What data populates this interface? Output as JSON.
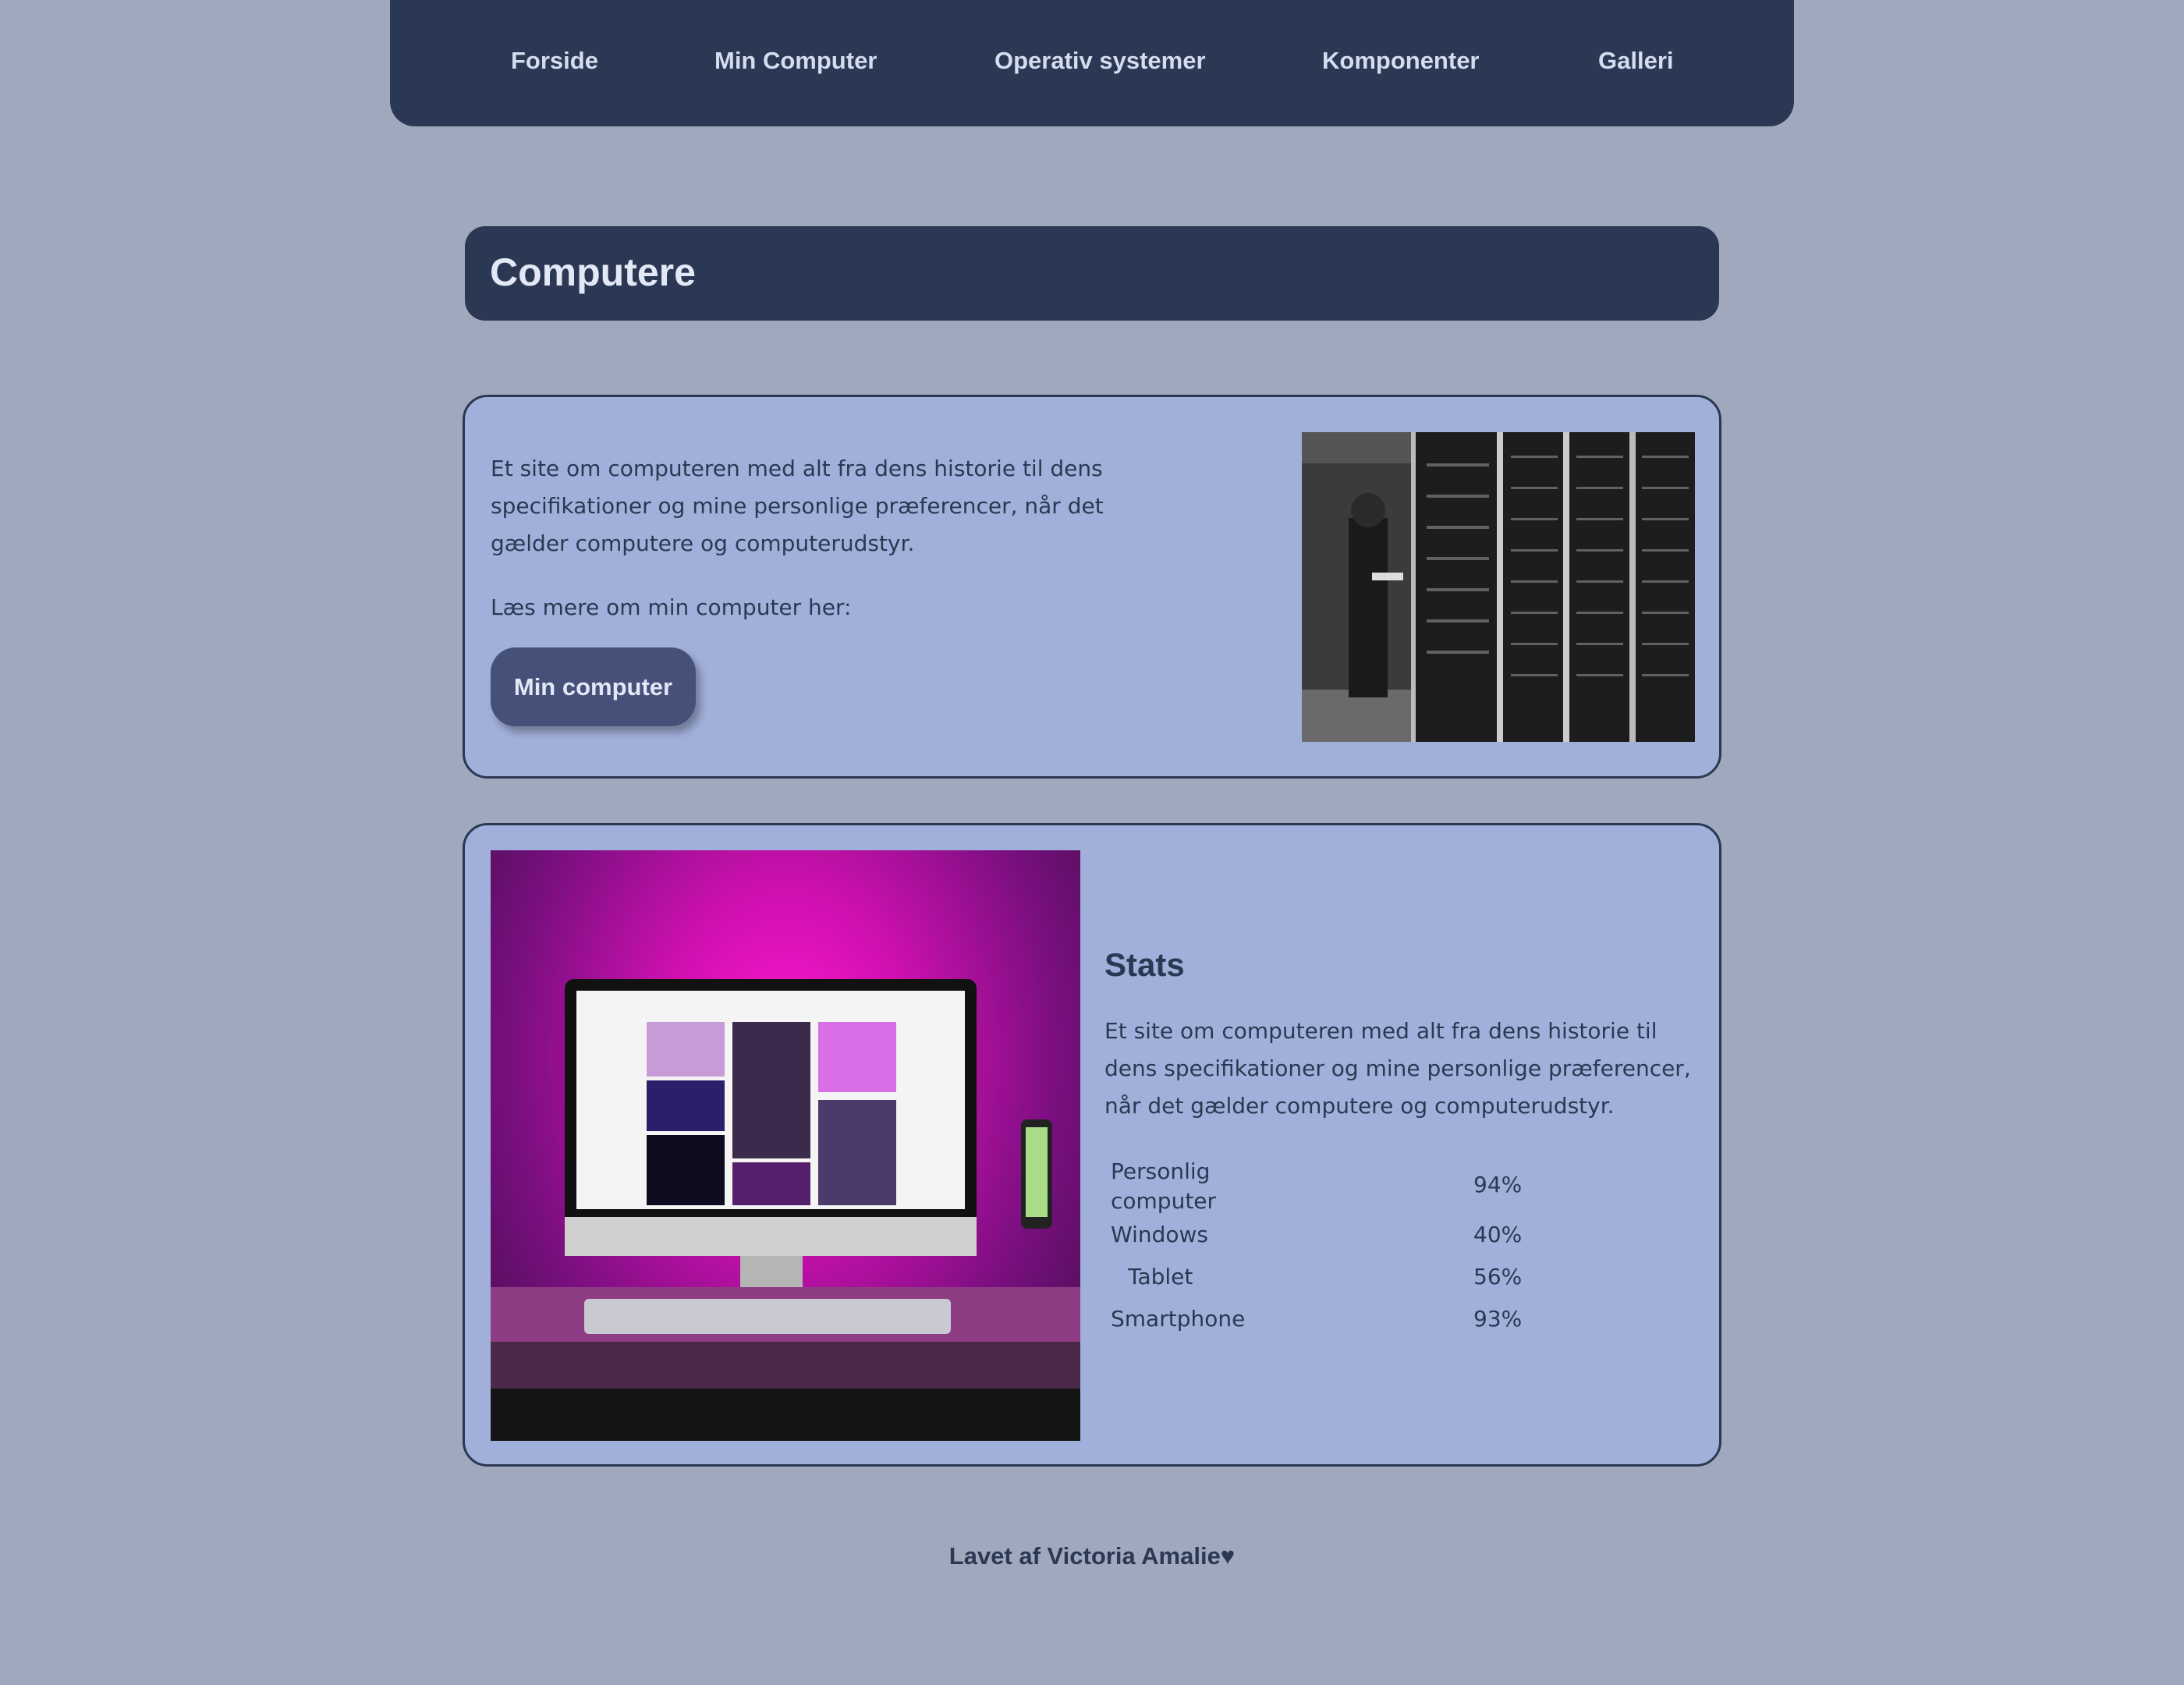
{
  "nav": {
    "items": [
      {
        "label": "Forside"
      },
      {
        "label": "Min Computer"
      },
      {
        "label": "Operativ systemer"
      },
      {
        "label": "Komponenter"
      },
      {
        "label": "Galleri"
      }
    ]
  },
  "header": {
    "title": "Computere"
  },
  "intro_card": {
    "text": "Et site om computeren med alt fra dens historie til dens specifikationer og mine personlige præferencer, når det gælder computere og computerudstyr.",
    "read_more": "Læs mere om min computer her:",
    "button_label": "Min computer"
  },
  "stats_card": {
    "title": "Stats",
    "text": "Et site om computeren med alt fra dens historie til dens specifikationer og mine personlige præferencer, når det gælder computere og computerudstyr.",
    "rows": [
      {
        "label": "Personlig computer",
        "value": "94%"
      },
      {
        "label": "Windows",
        "value": "40%"
      },
      {
        "label": "Tablet",
        "value": "56%"
      },
      {
        "label": "Smartphone",
        "value": "93%"
      }
    ]
  },
  "footer": {
    "text": "Lavet af Victoria Amalie♥"
  },
  "colors": {
    "background": "#a0a8bd",
    "nav": "#2b3853",
    "card": "#a1b0da",
    "button": "#46517a"
  }
}
